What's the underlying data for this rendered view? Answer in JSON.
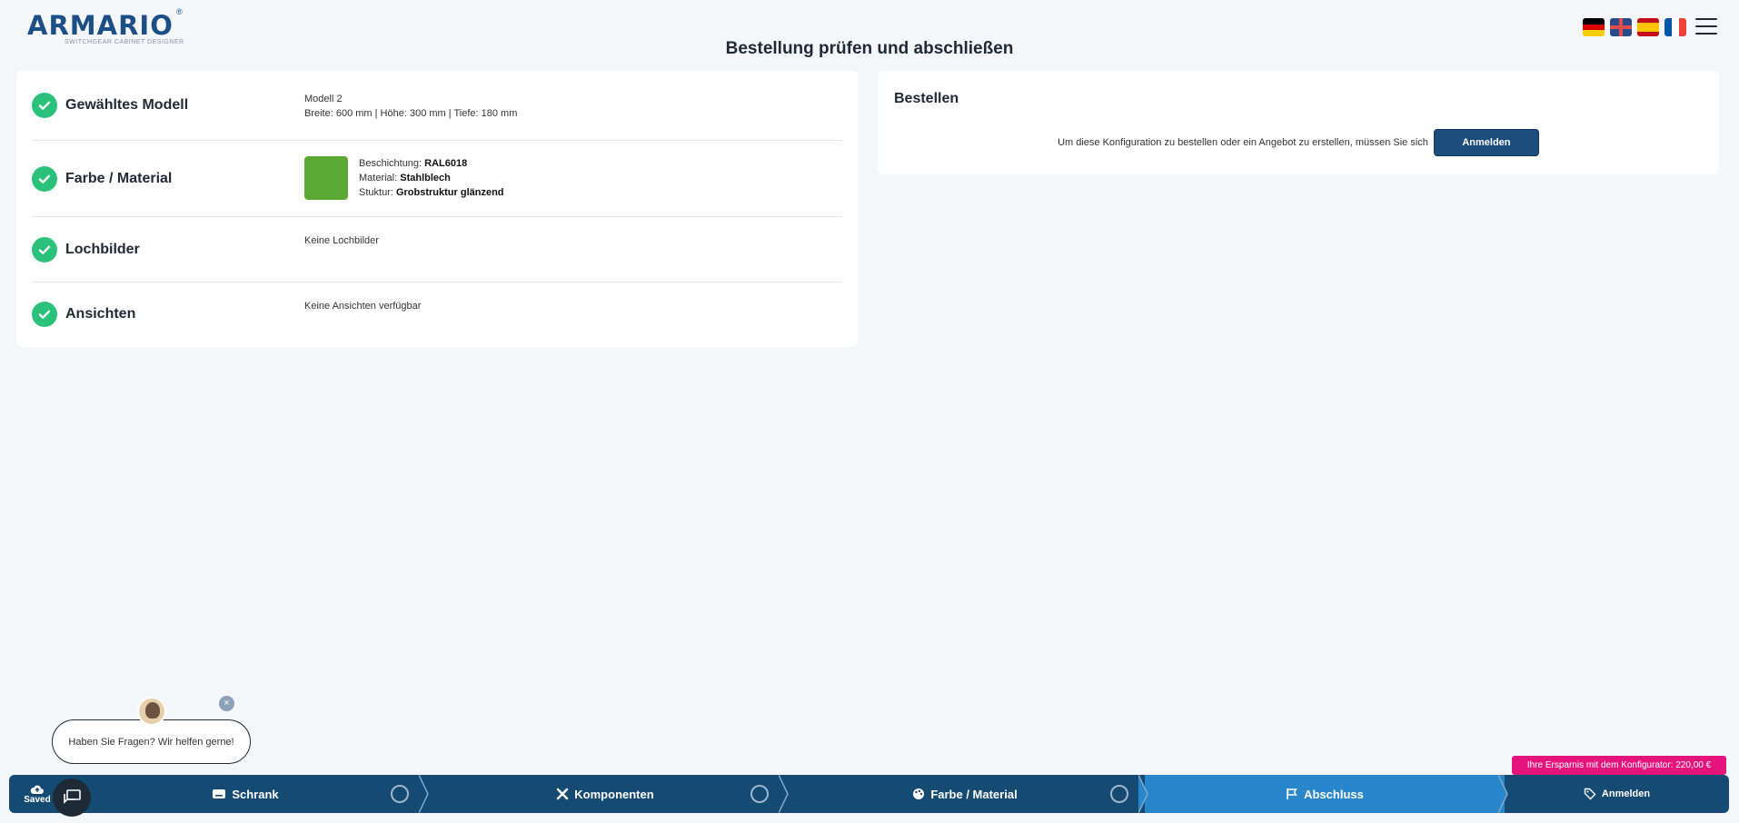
{
  "header": {
    "logo_text": "ARMARIO",
    "logo_reg": "®",
    "logo_tagline": "SWITCHGEAR CABINET DESIGNER",
    "page_title": "Bestellung prüfen und abschließen",
    "languages": [
      "de",
      "en",
      "es",
      "fr"
    ]
  },
  "review": {
    "rows": [
      {
        "label": "Gewähltes Modell",
        "lines": [
          "Modell 2",
          "Breite: 600 mm | Höhe: 300 mm | Tiefe: 180 mm"
        ]
      },
      {
        "label": "Farbe / Material",
        "swatch_color": "#5aaa34",
        "coating_label": "Beschichtung:",
        "coating_value": "RAL6018",
        "material_label": "Material:",
        "material_value": "Stahlblech",
        "structure_label": "Stuktur:",
        "structure_value": "Grobstruktur glänzend"
      },
      {
        "label": "Lochbilder",
        "lines": [
          "Keine Lochbilder"
        ]
      },
      {
        "label": "Ansichten",
        "lines": [
          "Keine Ansichten verfügbar"
        ]
      }
    ]
  },
  "order": {
    "title": "Bestellen",
    "message": "Um diese Konfiguration zu bestellen oder ein Angebot zu erstellen, müssen Sie sich",
    "login_label": "Anmelden"
  },
  "chat": {
    "message": "Haben Sie Fragen? Wir helfen gerne!",
    "close": "×"
  },
  "savings_badge": "Ihre Ersparnis mit dem Konfigurator: 220,00 €",
  "stepbar": {
    "saved_label": "Saved",
    "steps": [
      {
        "label": "Schrank",
        "icon": "keyboard-icon",
        "done": true
      },
      {
        "label": "Komponenten",
        "icon": "tools-icon",
        "done": true
      },
      {
        "label": "Farbe / Material",
        "icon": "palette-icon",
        "done": true
      },
      {
        "label": "Abschluss",
        "icon": "flag-icon",
        "active": true
      },
      {
        "label": "Anmelden",
        "icon": "tag-icon"
      }
    ]
  },
  "colors": {
    "primary": "#154b73",
    "active_step": "#2a86cb",
    "check": "#2bc17a",
    "savings": "#e5147c"
  }
}
